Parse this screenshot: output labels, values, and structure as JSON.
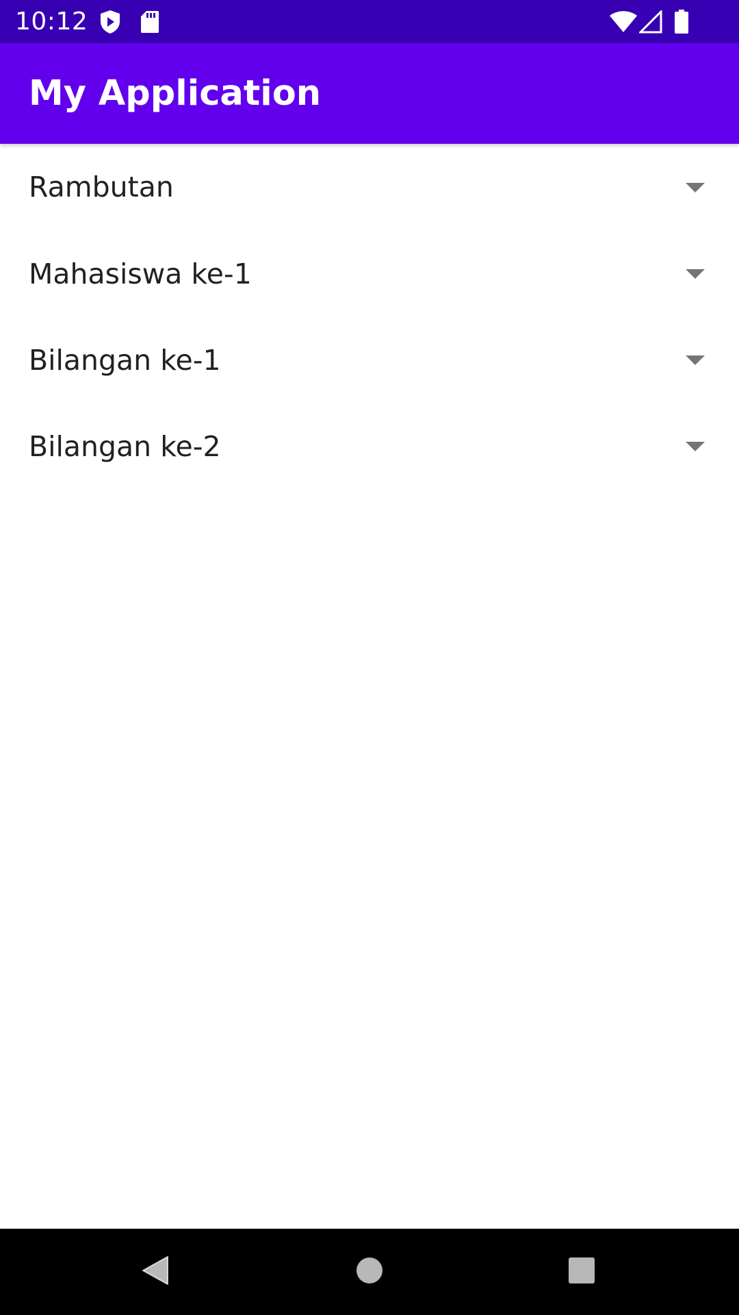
{
  "status_bar": {
    "time": "10:12",
    "icons": [
      "shield-play-icon",
      "sd-card-icon",
      "wifi-icon",
      "cellular-signal-icon",
      "battery-icon"
    ],
    "color": "#3700b3"
  },
  "app_bar": {
    "title": "My Application",
    "color": "#6200ee"
  },
  "spinners": [
    {
      "selected": "Rambutan"
    },
    {
      "selected": "Mahasiswa ke-1"
    },
    {
      "selected": "Bilangan ke-1"
    },
    {
      "selected": "Bilangan ke-2"
    }
  ],
  "nav_bar": {
    "buttons": [
      "back-icon",
      "home-icon",
      "recents-icon"
    ]
  }
}
